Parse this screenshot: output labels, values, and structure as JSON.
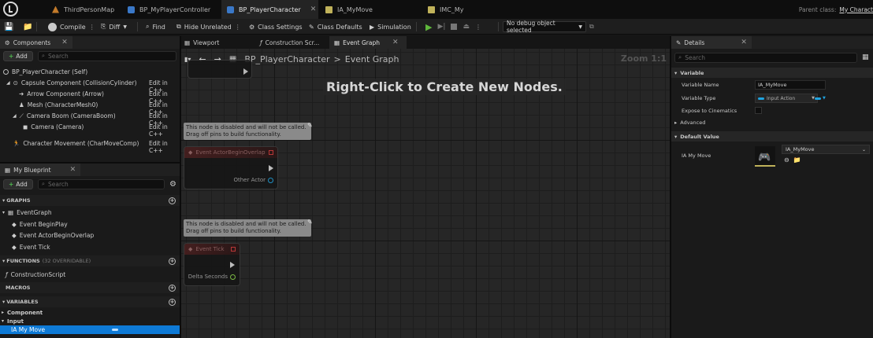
{
  "tabs": [
    {
      "label": "ThirdPersonMap",
      "icon": "level-map-icon"
    },
    {
      "label": "BP_MyPlayerController",
      "icon": "blueprint-class-icon"
    },
    {
      "label": "BP_PlayerCharacter",
      "icon": "blueprint-class-icon"
    },
    {
      "label": "IA_MyMove",
      "icon": "input-action-icon"
    },
    {
      "label": "IMC_My",
      "icon": "input-mapping-context-icon"
    }
  ],
  "parent_class": {
    "label": "Parent class:",
    "value": "My Charact"
  },
  "toolbar": {
    "compile": "Compile",
    "diff": "Diff",
    "find": "Find",
    "hide_unrelated": "Hide Unrelated",
    "class_settings": "Class Settings",
    "class_defaults": "Class Defaults",
    "simulation": "Simulation",
    "debug_object": "No debug object selected"
  },
  "components": {
    "title": "Components",
    "add": "Add",
    "search_placeholder": "Search",
    "root": "BP_PlayerCharacter (Self)",
    "items": [
      {
        "label": "Capsule Component (CollisionCylinder)",
        "edit": "Edit in C++"
      },
      {
        "label": "Arrow Component (Arrow)",
        "edit": "Edit in C++"
      },
      {
        "label": "Mesh (CharacterMesh0)",
        "edit": "Edit in C++"
      },
      {
        "label": "Camera Boom (CameraBoom)",
        "edit": "Edit in C++"
      },
      {
        "label": "Camera (Camera)",
        "edit": "Edit in C++"
      },
      {
        "label": "Character Movement (CharMoveComp)",
        "edit": "Edit in C++"
      }
    ]
  },
  "my_blueprint": {
    "title": "My Blueprint",
    "add": "Add",
    "search_placeholder": "Search",
    "graphs_label": "GRAPHS",
    "event_graph": "EventGraph",
    "events": [
      "Event BeginPlay",
      "Event ActorBeginOverlap",
      "Event Tick"
    ],
    "functions_label": "FUNCTIONS",
    "functions_count": "(32 OVERRIDABLE)",
    "construction_script": "ConstructionScript",
    "macros_label": "MACROS",
    "variables_label": "VARIABLES",
    "categories": [
      "Component",
      "Input"
    ],
    "variables": [
      "IA My Move"
    ]
  },
  "center_tabs": [
    "Viewport",
    "Construction Scr...",
    "Event Graph"
  ],
  "graph": {
    "breadcrumb_root": "BP_PlayerCharacter",
    "breadcrumb_sep": ">",
    "breadcrumb_current": "Event Graph",
    "zoom": "Zoom 1:1",
    "hint": "Right-Click to Create New Nodes.",
    "disabled_msg": "This node is disabled and will not be called. Drag off pins to build functionality.",
    "node_overlap_title": "Event ActorBeginOverlap",
    "node_overlap_pin": "Other Actor",
    "node_tick_title": "Event Tick",
    "node_tick_pin": "Delta Seconds"
  },
  "details": {
    "title": "Details",
    "search_placeholder": "Search",
    "variable_section": "Variable",
    "variable_name_label": "Variable Name",
    "variable_name_value": "IA_MyMove",
    "variable_type_label": "Variable Type",
    "variable_type_value": "Input Action",
    "expose_label": "Expose to Cinematics",
    "advanced_label": "Advanced",
    "default_section": "Default Value",
    "ia_label": "IA My Move",
    "ia_value": "IA_MyMove"
  },
  "colors": {
    "accent_blue": "#0e7ad6",
    "play_green": "#5fb83c",
    "disabled_red": "#d23a3a"
  }
}
